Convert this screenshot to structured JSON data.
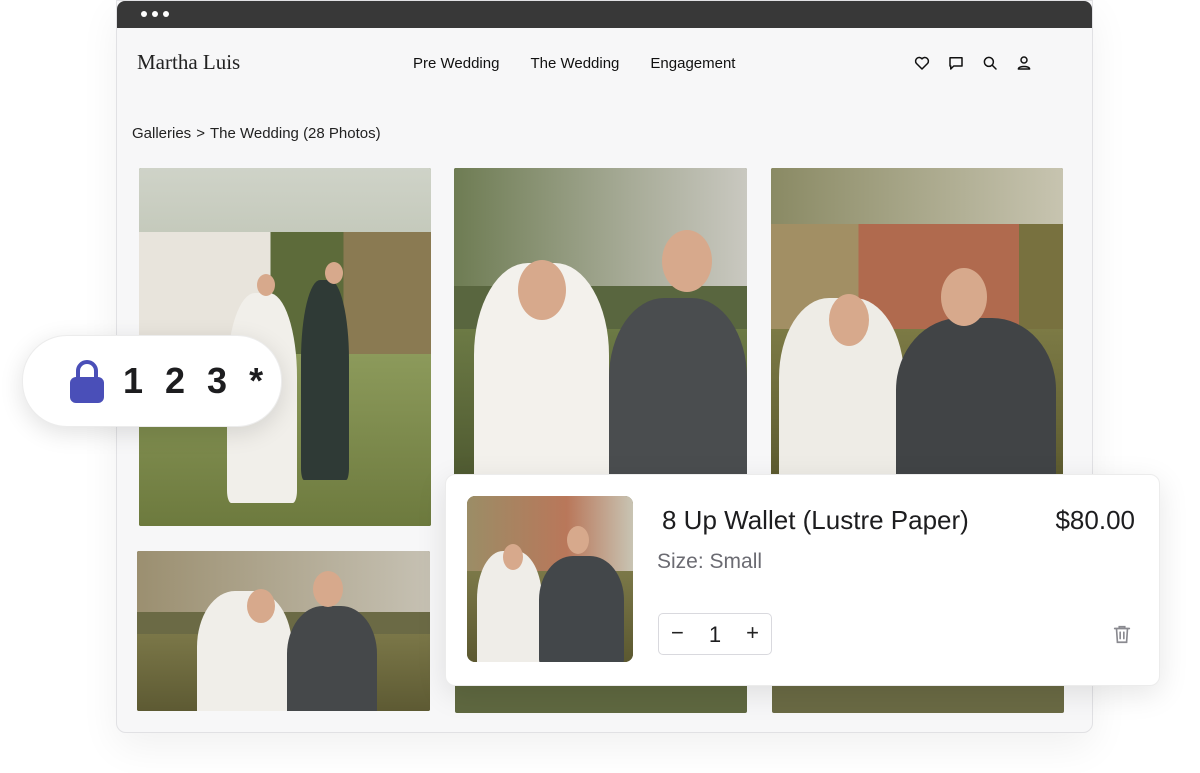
{
  "header": {
    "brand": "Martha Luis",
    "nav": [
      "Pre Wedding",
      "The Wedding",
      "Engagement"
    ],
    "icons": [
      "heart-icon",
      "chat-icon",
      "search-icon",
      "user-icon"
    ]
  },
  "breadcrumb": {
    "root": "Galleries",
    "separator": ">",
    "current": "The Wedding (28 Photos)"
  },
  "password_badge": {
    "icon": "lock-icon",
    "text": "1 2 3 *",
    "accent": "#4a4fb8"
  },
  "cart_item": {
    "name": "8 Up Wallet (Lustre Paper)",
    "price": "$80.00",
    "size": "Size: Small",
    "quantity": "1",
    "minus": "−",
    "plus": "+",
    "delete_icon": "trash-icon"
  },
  "colors": {
    "titlebar": "#383838",
    "window_bg": "#f7f7f8",
    "accent": "#4a4fb8"
  }
}
